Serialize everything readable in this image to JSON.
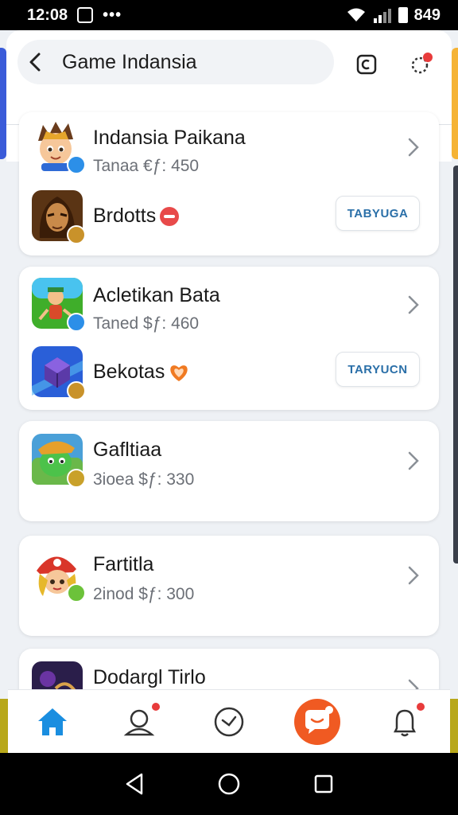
{
  "status_bar": {
    "time": "12:08",
    "dots": "•••",
    "right_text": "849"
  },
  "header": {
    "title": "Game Indansia"
  },
  "cards": [
    {
      "rows": [
        {
          "name": "Indansia Paikana",
          "sub": "Tanaa €ƒ: 450",
          "icon": "hero-boy-icon"
        },
        {
          "name": "Brdotts",
          "button": "TABYUGA",
          "icon": "warrior-icon"
        }
      ]
    },
    {
      "rows": [
        {
          "name": "Acletikan Bata",
          "sub": "Taned $ƒ: 460",
          "icon": "field-game-icon"
        },
        {
          "name": "Bekotas",
          "button": "TARYUCN",
          "icon": "crystal-box-icon"
        }
      ]
    },
    {
      "rows": [
        {
          "name": "Gafltiaa",
          "sub": "3ioea $ƒ: 330",
          "icon": "green-creature-icon"
        }
      ]
    },
    {
      "rows": [
        {
          "name": "Fartitla",
          "sub": "2inod $ƒ: 300",
          "icon": "pirate-girl-icon"
        }
      ]
    },
    {
      "rows": [
        {
          "name": "Dodargl Tirlo",
          "icon": "dark-fantasy-icon"
        }
      ]
    }
  ],
  "colors": {
    "accent_blue": "#1a8ee0",
    "chat_orange": "#f05a22",
    "badge_red": "#e83b3b",
    "button_text": "#2a6fa8"
  }
}
